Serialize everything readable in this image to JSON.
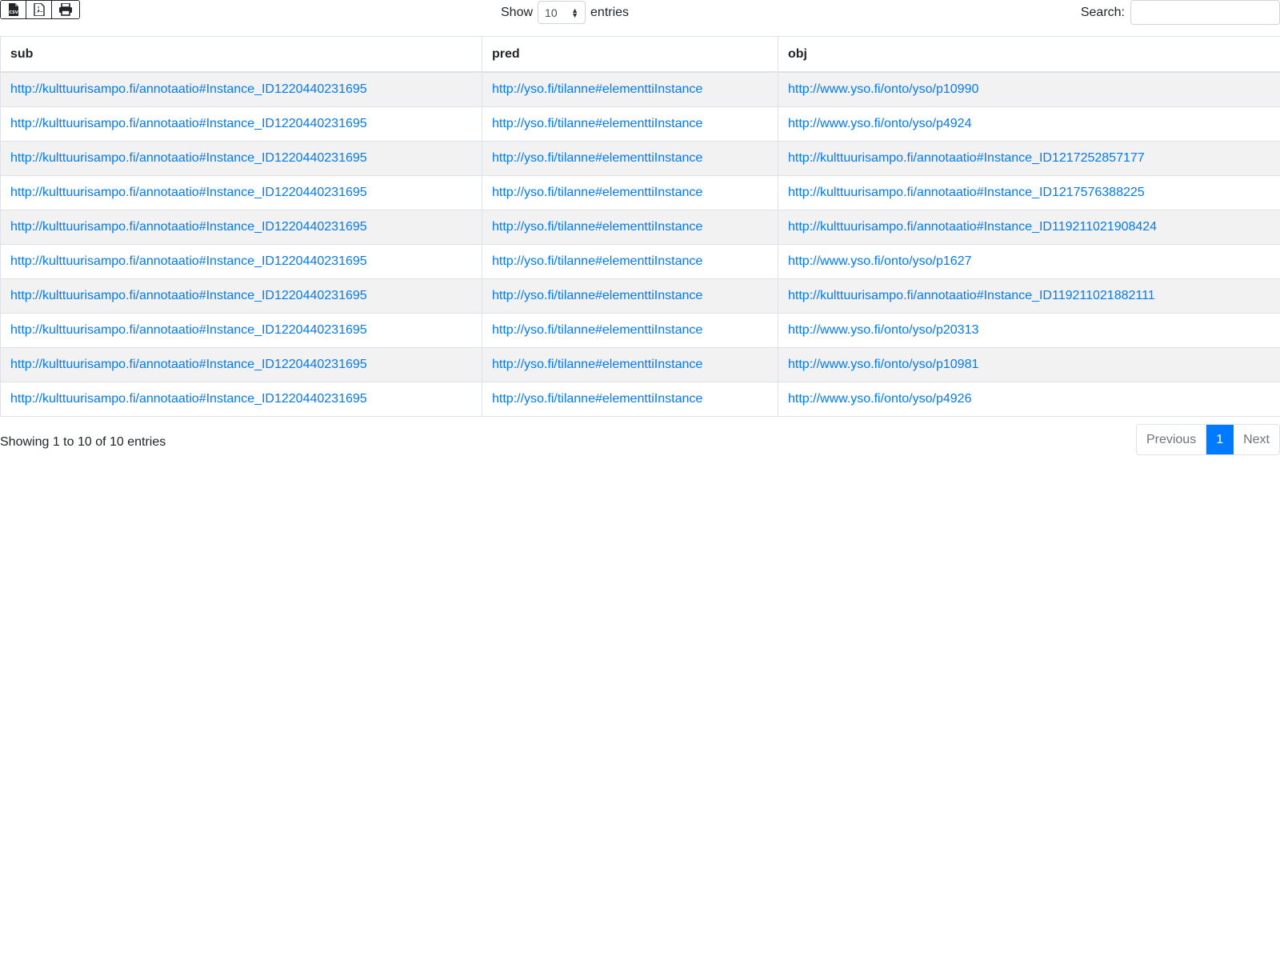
{
  "toolbar": {
    "export_buttons": [
      {
        "icon": "csv-file-icon"
      },
      {
        "icon": "pdf-file-icon"
      },
      {
        "icon": "print-icon"
      }
    ],
    "length": {
      "show_label": "Show",
      "selected": "10",
      "entries_label": "entries"
    },
    "search": {
      "label": "Search:",
      "value": ""
    }
  },
  "table": {
    "columns": [
      "sub",
      "pred",
      "obj"
    ],
    "rows": [
      [
        "http://kulttuurisampo.fi/annotaatio#Instance_ID1220440231695",
        "http://yso.fi/tilanne#elementtiInstance",
        "http://www.yso.fi/onto/yso/p10990"
      ],
      [
        "http://kulttuurisampo.fi/annotaatio#Instance_ID1220440231695",
        "http://yso.fi/tilanne#elementtiInstance",
        "http://www.yso.fi/onto/yso/p4924"
      ],
      [
        "http://kulttuurisampo.fi/annotaatio#Instance_ID1220440231695",
        "http://yso.fi/tilanne#elementtiInstance",
        "http://kulttuurisampo.fi/annotaatio#Instance_ID1217252857177"
      ],
      [
        "http://kulttuurisampo.fi/annotaatio#Instance_ID1220440231695",
        "http://yso.fi/tilanne#elementtiInstance",
        "http://kulttuurisampo.fi/annotaatio#Instance_ID1217576388225"
      ],
      [
        "http://kulttuurisampo.fi/annotaatio#Instance_ID1220440231695",
        "http://yso.fi/tilanne#elementtiInstance",
        "http://kulttuurisampo.fi/annotaatio#Instance_ID119211021908424"
      ],
      [
        "http://kulttuurisampo.fi/annotaatio#Instance_ID1220440231695",
        "http://yso.fi/tilanne#elementtiInstance",
        "http://www.yso.fi/onto/yso/p1627"
      ],
      [
        "http://kulttuurisampo.fi/annotaatio#Instance_ID1220440231695",
        "http://yso.fi/tilanne#elementtiInstance",
        "http://kulttuurisampo.fi/annotaatio#Instance_ID119211021882111"
      ],
      [
        "http://kulttuurisampo.fi/annotaatio#Instance_ID1220440231695",
        "http://yso.fi/tilanne#elementtiInstance",
        "http://www.yso.fi/onto/yso/p20313"
      ],
      [
        "http://kulttuurisampo.fi/annotaatio#Instance_ID1220440231695",
        "http://yso.fi/tilanne#elementtiInstance",
        "http://www.yso.fi/onto/yso/p10981"
      ],
      [
        "http://kulttuurisampo.fi/annotaatio#Instance_ID1220440231695",
        "http://yso.fi/tilanne#elementtiInstance",
        "http://www.yso.fi/onto/yso/p4926"
      ]
    ]
  },
  "footer": {
    "info": "Showing 1 to 10 of 10 entries",
    "pagination": {
      "previous": "Previous",
      "current": "1",
      "next": "Next"
    }
  },
  "colors": {
    "link": "#007bff",
    "active_page": "#007bff",
    "stripe": "#f2f2f2"
  }
}
